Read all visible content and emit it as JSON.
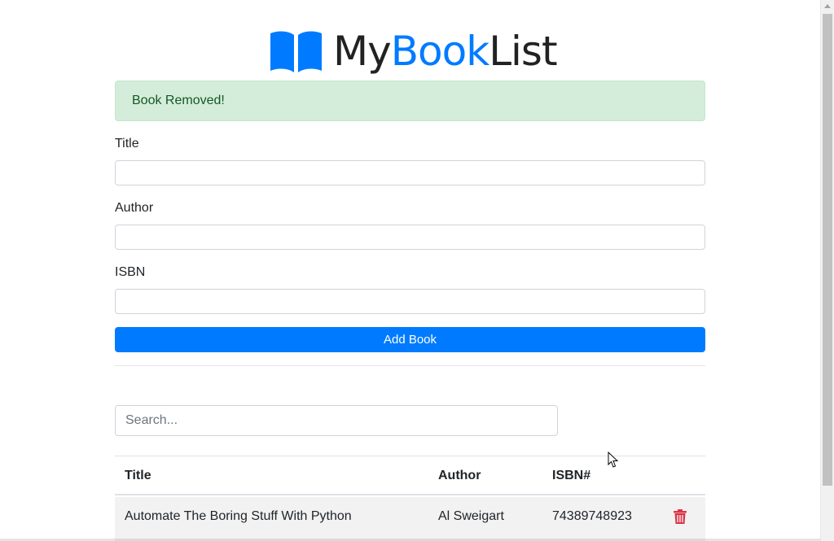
{
  "brand": {
    "part1": "My",
    "part2": "Book",
    "part3": "List",
    "accent_color": "#007bff",
    "icon": "book-open-icon"
  },
  "alert": {
    "message": "Book Removed!",
    "type": "success"
  },
  "form": {
    "title_label": "Title",
    "title_value": "",
    "author_label": "Author",
    "author_value": "",
    "isbn_label": "ISBN",
    "isbn_value": "",
    "submit_label": "Add Book"
  },
  "search": {
    "placeholder": "Search...",
    "value": ""
  },
  "table": {
    "headers": [
      "Title",
      "Author",
      "ISBN#"
    ],
    "rows": [
      {
        "title": "Automate The Boring Stuff With Python",
        "author": "Al Sweigart",
        "isbn": "74389748923",
        "action_icon": "trash-icon"
      }
    ]
  },
  "colors": {
    "primary": "#007bff",
    "danger": "#dc3545",
    "success_bg": "#d4edda",
    "success_text": "#155724"
  }
}
